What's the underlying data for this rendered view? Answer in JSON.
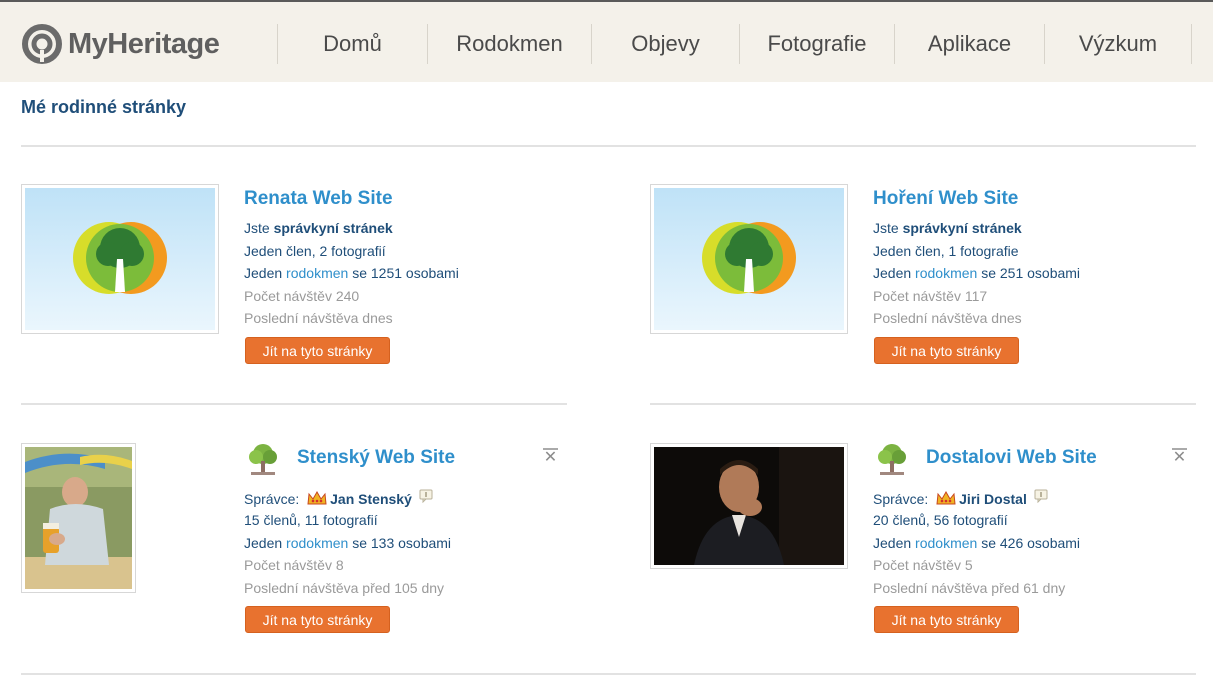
{
  "brand": {
    "name": "MyHeritage"
  },
  "nav": {
    "items": [
      {
        "label": "Domů"
      },
      {
        "label": "Rodokmen"
      },
      {
        "label": "Objevy"
      },
      {
        "label": "Fotografie"
      },
      {
        "label": "Aplikace"
      },
      {
        "label": "Výzkum"
      }
    ]
  },
  "page": {
    "title": "Mé rodinné stránky"
  },
  "sites": [
    {
      "title": "Renata Web Site",
      "role_prefix": "Jste",
      "role": "správkyní stránek",
      "members": "Jeden člen, 2 fotografií",
      "tree_prefix": "Jeden",
      "tree_link": "rodokmen",
      "tree_suffix": "se 1251 osobami",
      "visits": "Počet návštěv 240",
      "last_visit": "Poslední návštěva dnes",
      "button": "Jít na tyto stránky"
    },
    {
      "title": "Hoření Web Site",
      "role_prefix": "Jste",
      "role": "správkyní stránek",
      "members": "Jeden člen, 1 fotografie",
      "tree_prefix": "Jeden",
      "tree_link": "rodokmen",
      "tree_suffix": "se 251 osobami",
      "visits": "Počet návštěv 117",
      "last_visit": "Poslední návštěva dnes",
      "button": "Jít na tyto stránky"
    },
    {
      "title": "Stenský Web Site",
      "manager_prefix": "Správce:",
      "manager": "Jan Stenský",
      "members": "15 členů, 11 fotografií",
      "tree_prefix": "Jeden",
      "tree_link": "rodokmen",
      "tree_suffix": "se 133 osobami",
      "visits": "Počet návštěv 8",
      "last_visit": "Poslední návštěva před 105 dny",
      "button": "Jít na tyto stránky"
    },
    {
      "title": "Dostalovi Web Site",
      "manager_prefix": "Správce:",
      "manager": "Jiri Dostal",
      "members": "20 členů, 56 fotografií",
      "tree_prefix": "Jeden",
      "tree_link": "rodokmen",
      "tree_suffix": "se 426 osobami",
      "visits": "Počet návštěv 5",
      "last_visit": "Poslední návštěva před 61 dny",
      "button": "Jít na tyto stránky"
    }
  ],
  "colors": {
    "header_bg": "#f4f1ea",
    "title_blue": "#2f8fcb",
    "dark_blue": "#1f4e79",
    "button_orange": "#e8722f",
    "muted_grey": "#9a9a9a"
  }
}
